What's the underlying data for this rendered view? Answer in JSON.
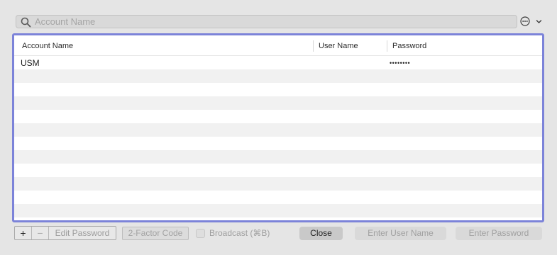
{
  "search": {
    "placeholder": "Account Name",
    "value": ""
  },
  "header_icons": {
    "more": "ellipsis-circle-icon",
    "dropdown": "chevron-down-icon"
  },
  "table": {
    "columns": [
      "Account Name",
      "User Name",
      "Password"
    ],
    "rows": [
      {
        "account": "USM",
        "user": "",
        "password": "••••••••"
      }
    ],
    "empty_row_count": 11
  },
  "toolbar": {
    "add_label": "+",
    "remove_label": "−",
    "edit_password_label": "Edit Password",
    "two_factor_label": "2-Factor Code",
    "broadcast_label": "Broadcast (⌘B)",
    "broadcast_checked": false,
    "close_label": "Close",
    "enter_user_label": "Enter User Name",
    "enter_password_label": "Enter Password"
  },
  "colors": {
    "selection_border": "#7c83d9",
    "window_bg": "#e5e5e5",
    "alt_row": "#f1f1f1"
  }
}
